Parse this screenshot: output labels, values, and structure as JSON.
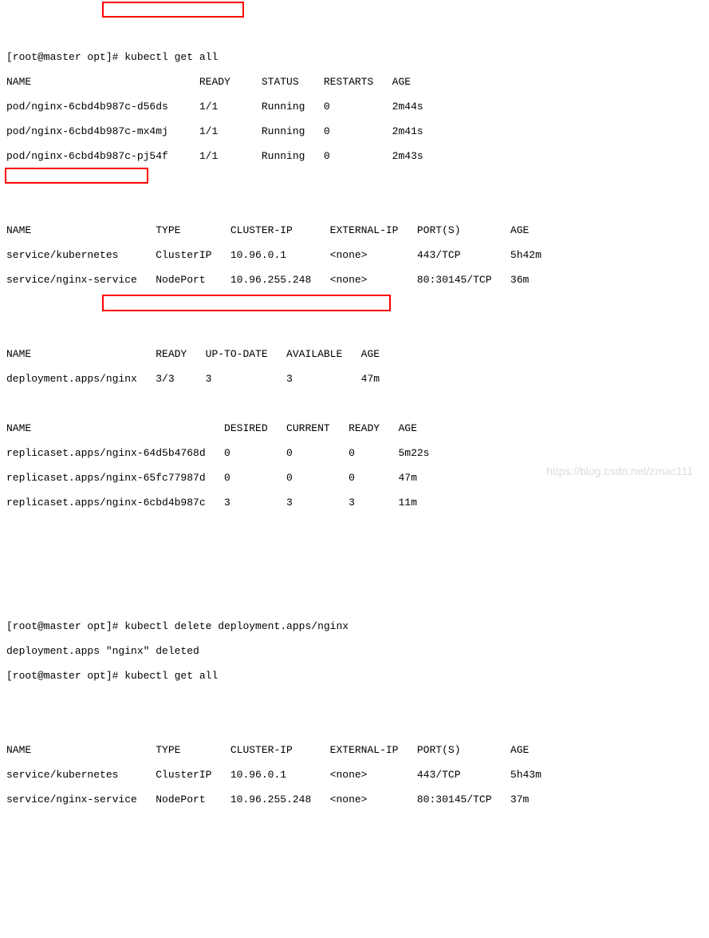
{
  "prompt1": "[root@master opt]# kubectl get all",
  "pods_header": "NAME                           READY     STATUS    RESTARTS   AGE",
  "pods": [
    "pod/nginx-6cbd4b987c-d56ds     1/1       Running   0          2m44s",
    "pod/nginx-6cbd4b987c-mx4mj     1/1       Running   0          2m41s",
    "pod/nginx-6cbd4b987c-pj54f     1/1       Running   0          2m43s"
  ],
  "svc_header": "NAME                    TYPE        CLUSTER-IP      EXTERNAL-IP   PORT(S)        AGE",
  "svcs": [
    "service/kubernetes      ClusterIP   10.96.0.1       <none>        443/TCP        5h42m",
    "service/nginx-service   NodePort    10.96.255.248   <none>        80:30145/TCP   36m"
  ],
  "deploy_header": "NAME                    READY   UP-TO-DATE   AVAILABLE   AGE",
  "deploys": [
    "deployment.apps/nginx   3/3     3            3           47m"
  ],
  "rs_header": "NAME                               DESIRED   CURRENT   READY   AGE",
  "rs": [
    "replicaset.apps/nginx-64d5b4768d   0         0         0       5m22s",
    "replicaset.apps/nginx-65fc77987d   0         0         0       47m",
    "replicaset.apps/nginx-6cbd4b987c   3         3         3       11m"
  ],
  "prompt2": "[root@master opt]# kubectl delete deployment.apps/nginx",
  "delete_out": "deployment.apps \"nginx\" deleted",
  "prompt3": "[root@master opt]# kubectl get all",
  "svc2_header": "NAME                    TYPE        CLUSTER-IP      EXTERNAL-IP   PORT(S)        AGE",
  "svcs2": [
    "service/kubernetes      ClusterIP   10.96.0.1       <none>        443/TCP        5h43m",
    "service/nginx-service   NodePort    10.96.255.248   <none>        80:30145/TCP   37m"
  ],
  "watermark": "https://blog.csdn.net/zmac111"
}
